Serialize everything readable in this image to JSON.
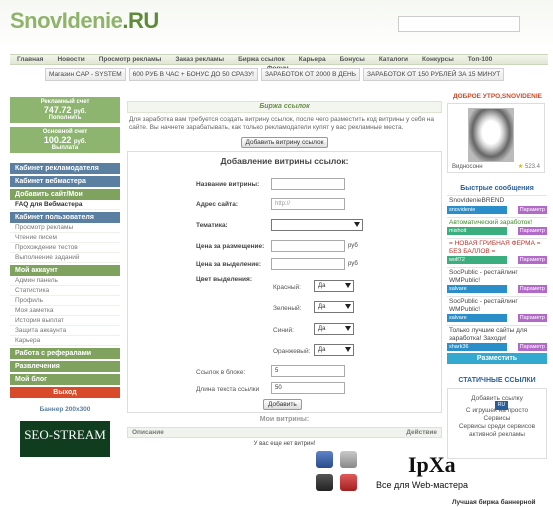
{
  "header": {
    "logo_main": "SnovIdenie",
    "logo_tld": ".RU"
  },
  "nav": [
    "Главная",
    "Новости",
    "Просмотр рекламы",
    "Заказ рекламы",
    "Биржа ссылок",
    "Карьера",
    "Бонусы",
    "Каталоги",
    "Конкурсы",
    "Топ-100"
  ],
  "forum": "Форум",
  "ads": [
    "Магазин CAP - SYSTEM",
    "600 РУБ В ЧАС + БОНУС ДО 50 СРАЗУ!",
    "ЗАРАБОТОК ОТ 2000 В ДЕНЬ",
    "ЗАРАБОТОК ОТ 150 РУБЛЕЙ ЗА 15 МИНУТ"
  ],
  "left": {
    "ad_balance": {
      "title": "Рекламный счет",
      "amount": "747.72",
      "currency": "руб.",
      "action": "Пополнить"
    },
    "main_balance": {
      "title": "Основной счет",
      "amount": "100.22",
      "currency": "руб.",
      "action": "Выплата"
    },
    "menu": {
      "advertiser": "Кабинет рекламодателя",
      "webmaster": "Кабинет вебмастера",
      "add_site": "Добавить сайт/Мои витрины",
      "faq": "FAQ для Вебмастера",
      "user_cab": "Кабинет пользователя",
      "user_items": [
        "Просмотр рекламы",
        "Чтение писем",
        "Прохождение тестов",
        "Выполнение заданий"
      ],
      "my_account": "Мой аккаунт",
      "account_items": [
        "Админ панель",
        "Статистика",
        "Профиль",
        "Моя заметка",
        "История выплат",
        "Защита аккаунта",
        "Карьера"
      ],
      "referrals": "Работа с рефералами",
      "entertainment": "Развлечения",
      "my_blog": "Мой блог",
      "exit": "Выход"
    },
    "banner_title": "Баннер 200x300",
    "banner_text": "SEO-STREAM"
  },
  "center": {
    "title": "Биржа ссылок",
    "intro": "Для заработка вам требуется создать витрину ссылок, после чего разместить код витрины у себя на сайте. Вы начнете зарабатывать, как только рекламодатели купят у вас рекламные места.",
    "add_button": "Добавить витрину ссылок",
    "form": {
      "title": "Добавление витрины ссылок:",
      "name_label": "Название витрины:",
      "url_label": "Адрес сайта:",
      "url_placeholder": "http://",
      "theme_label": "Тематика:",
      "price_place_label": "Цена за размещение:",
      "price_select_label": "Цена за выделение:",
      "currency": "руб",
      "color_label": "Цвет выделения:",
      "red": "Красный:",
      "green": "Зеленый:",
      "blue": "Синий:",
      "orange": "Оранжевый:",
      "yes": "Да",
      "links_label": "Ссылок в блоке:",
      "links_value": "5",
      "length_label": "Длина текста ссылки",
      "length_value": "50",
      "submit": "Добавить"
    },
    "my_vitrines": "Мои витрины:",
    "col_desc": "Описание",
    "col_action": "Действие",
    "empty": "У вас еще нет витрин!"
  },
  "watermark": {
    "logo": "IpXa",
    "sub": "Все для Web-мастера",
    "badge": "RU"
  },
  "right": {
    "greeting": "ДОБРОЕ УТРО,SNOVIDENIE",
    "user_name": "Видносонн",
    "rating": "523.4",
    "fast_title": "Быстрые сообщения",
    "messages": [
      {
        "text": "SnovIdenieBREND",
        "user": "snovidenie",
        "tag": "Параметр",
        "color": "dark",
        "ucolor": "blue"
      },
      {
        "text": "Автоматический заработок!",
        "user": "mishoit",
        "tag": "Параметр",
        "color": "green",
        "ucolor": "green"
      },
      {
        "text": "= НОВАЯ ГРИБНАЯ ФЕРМА = БЕЗ БАЛЛОВ =",
        "user": "wolf72",
        "tag": "Параметр",
        "color": "red",
        "ucolor": "blue"
      },
      {
        "text": "SocPublic - рестайлинг WMPublic!",
        "user": "salvare",
        "tag": "Параметр",
        "color": "dark",
        "ucolor": "blue"
      },
      {
        "text": "SocPublic - рестайлинг WMPublic!",
        "user": "salvare",
        "tag": "Параметр",
        "color": "dark",
        "ucolor": "blue"
      },
      {
        "text": "Только лучшие сайты для заработка! Заходи!",
        "user": "shark36",
        "tag": "Параметр",
        "color": "dark",
        "ucolor": "green"
      }
    ],
    "place_btn": "Разместить",
    "static_title": "СТАТИЧНЫЕ ССЫЛКИ",
    "static_items": [
      "Добавить ссылку",
      "С игрушек на просто",
      "Сервисы",
      "Сервисы среди сервисов активной рекламы"
    ],
    "banner_exchange": "Лучшая биржа баннерной"
  }
}
